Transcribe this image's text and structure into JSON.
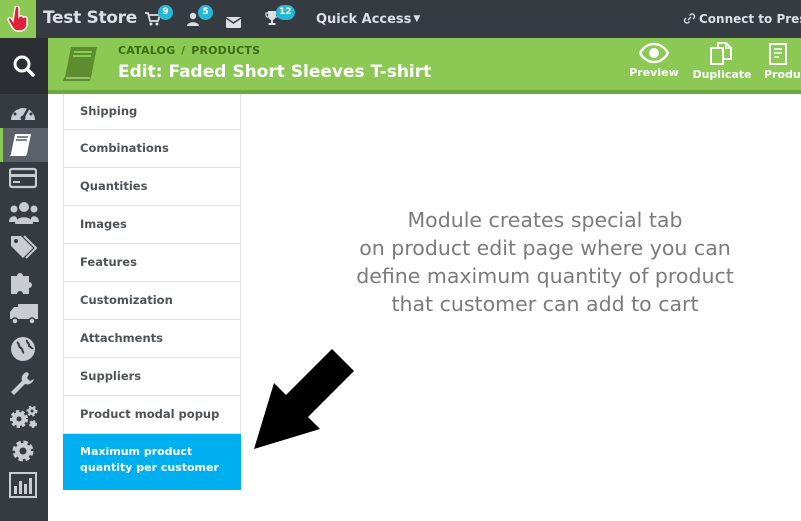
{
  "topbar": {
    "store_name": "Test Store",
    "orders_count": "9",
    "customers_count": "5",
    "trophy_count": "12",
    "quick_access": "Quick Access",
    "connect_label": "Connect to Presta"
  },
  "sidebar": {
    "items": [
      {
        "icon": "dashboard-icon"
      },
      {
        "icon": "catalog-book-icon",
        "active": true
      },
      {
        "icon": "credit-card-icon"
      },
      {
        "icon": "customers-icon"
      },
      {
        "icon": "tags-icon"
      },
      {
        "icon": "modules-puzzle-icon"
      },
      {
        "icon": "shipping-truck-icon"
      },
      {
        "icon": "globe-icon"
      },
      {
        "icon": "wrench-icon"
      },
      {
        "icon": "advanced-gears-icon"
      },
      {
        "icon": "settings-gear-icon"
      },
      {
        "icon": "stats-chart-icon"
      }
    ]
  },
  "header": {
    "breadcrumb": [
      "CATALOG",
      "PRODUCTS"
    ],
    "breadcrumb_separator": "/",
    "title": "Edit: Faded Short Sleeves T-shirt",
    "buttons": {
      "preview": "Preview",
      "duplicate": "Duplicate",
      "product": "Produ"
    }
  },
  "tabs": [
    {
      "label": "Shipping"
    },
    {
      "label": "Combinations"
    },
    {
      "label": "Quantities"
    },
    {
      "label": "Images"
    },
    {
      "label": "Features"
    },
    {
      "label": "Customization"
    },
    {
      "label": "Attachments"
    },
    {
      "label": "Suppliers"
    },
    {
      "label": "Product modal popup"
    },
    {
      "label": "Maximum product quantity per customer",
      "line1": "Maximum product",
      "line2": "quantity per customer",
      "active": true
    }
  ],
  "annotation": {
    "lines": [
      "Module creates special tab",
      "on product edit page where you can",
      "define maximum quantity of product",
      "that customer can add to cart"
    ]
  },
  "colors": {
    "topbar": "#363a41",
    "accent_green": "#8bc954",
    "active_tab": "#00aff0",
    "badge": "#25b9d7"
  }
}
